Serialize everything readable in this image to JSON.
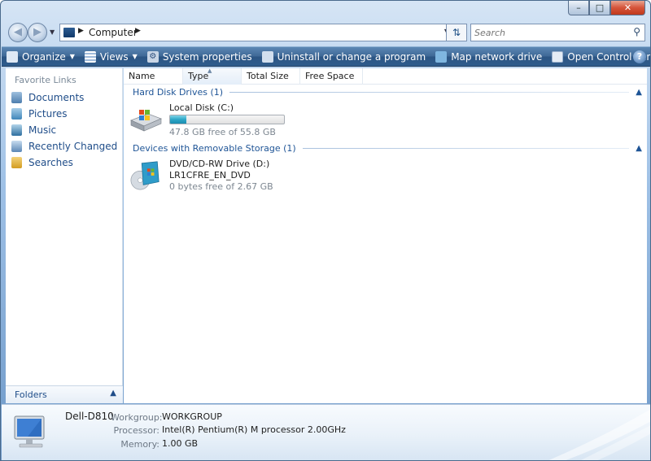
{
  "window": {
    "caption_min": "–",
    "caption_max": "□",
    "caption_close": "✕"
  },
  "address": {
    "crumb": "Computer",
    "search_placeholder": "Search"
  },
  "toolbar": {
    "items": [
      {
        "label": "Organize",
        "icon": "organize-icon",
        "dropdown": true
      },
      {
        "label": "Views",
        "icon": "views-icon",
        "dropdown": true
      },
      {
        "label": "System properties",
        "icon": "system-properties-icon"
      },
      {
        "label": "Uninstall or change a program",
        "icon": "uninstall-icon"
      },
      {
        "label": "Map network drive",
        "icon": "map-drive-icon"
      },
      {
        "label": "Open Control Panel",
        "icon": "control-panel-icon"
      }
    ],
    "help": "?"
  },
  "navpane": {
    "header": "Favorite Links",
    "links": [
      {
        "label": "Documents",
        "icon": "documents-icon"
      },
      {
        "label": "Pictures",
        "icon": "pictures-icon"
      },
      {
        "label": "Music",
        "icon": "music-icon"
      },
      {
        "label": "Recently Changed",
        "icon": "recently-changed-icon"
      },
      {
        "label": "Searches",
        "icon": "searches-icon"
      }
    ],
    "folders_label": "Folders"
  },
  "columns": [
    "Name",
    "Type",
    "Total Size",
    "Free Space"
  ],
  "groups": [
    {
      "title": "Hard Disk Drives (1)",
      "drives": [
        {
          "name": "Local Disk (C:)",
          "free_text": "47.8 GB free of 55.8 GB",
          "used_fraction": 0.14
        }
      ]
    },
    {
      "title": "Devices with Removable Storage (1)",
      "drives": [
        {
          "name": "DVD/CD-RW Drive (D:)",
          "label": "LR1CFRE_EN_DVD",
          "free_text": "0 bytes free of 2.67 GB"
        }
      ]
    }
  ],
  "details": {
    "computer_name": "Dell-D810",
    "workgroup_key": "Workgroup:",
    "workgroup_val": "WORKGROUP",
    "processor_key": "Processor:",
    "processor_val": "Intel(R) Pentium(R) M processor 2.00GHz",
    "memory_key": "Memory:",
    "memory_val": "1.00 GB"
  },
  "colors": {
    "toolbar": "#3f6997",
    "link": "#1f4d89",
    "group": "#1e5496",
    "usage_bar": "#2da7c7"
  }
}
